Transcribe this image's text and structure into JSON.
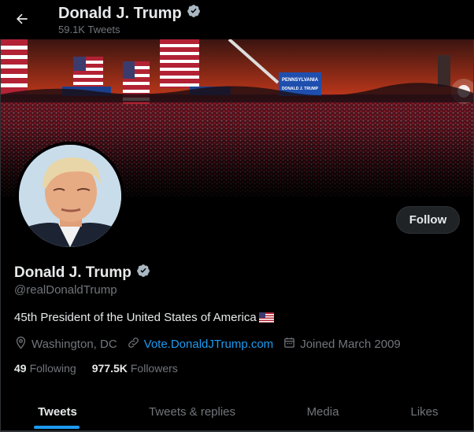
{
  "header": {
    "name": "Donald J. Trump",
    "tweet_count": "59.1K Tweets"
  },
  "banner": {
    "sign_text_1": "PENNSYLVANIA",
    "sign_text_2": "DONALD J. TRUMP"
  },
  "profile": {
    "name": "Donald J. Trump",
    "handle": "@realDonaldTrump",
    "bio": "45th President of the United States of America",
    "location": "Washington, DC",
    "website": "Vote.DonaldJTrump.com",
    "joined": "Joined March 2009",
    "following_count": "49",
    "following_label": "Following",
    "followers_count": "977.5K",
    "followers_label": "Followers",
    "follow_button": "Follow"
  },
  "tabs": [
    {
      "label": "Tweets",
      "active": true
    },
    {
      "label": "Tweets & replies",
      "active": false
    },
    {
      "label": "Media",
      "active": false
    },
    {
      "label": "Likes",
      "active": false
    }
  ],
  "colors": {
    "accent": "#1d9bf0",
    "background": "#000000",
    "text_primary": "#e7e9ea",
    "text_secondary": "#71767b"
  },
  "icons": [
    "back-arrow-icon",
    "verified-badge-icon",
    "location-pin-icon",
    "link-icon",
    "calendar-icon",
    "us-flag-emoji"
  ]
}
